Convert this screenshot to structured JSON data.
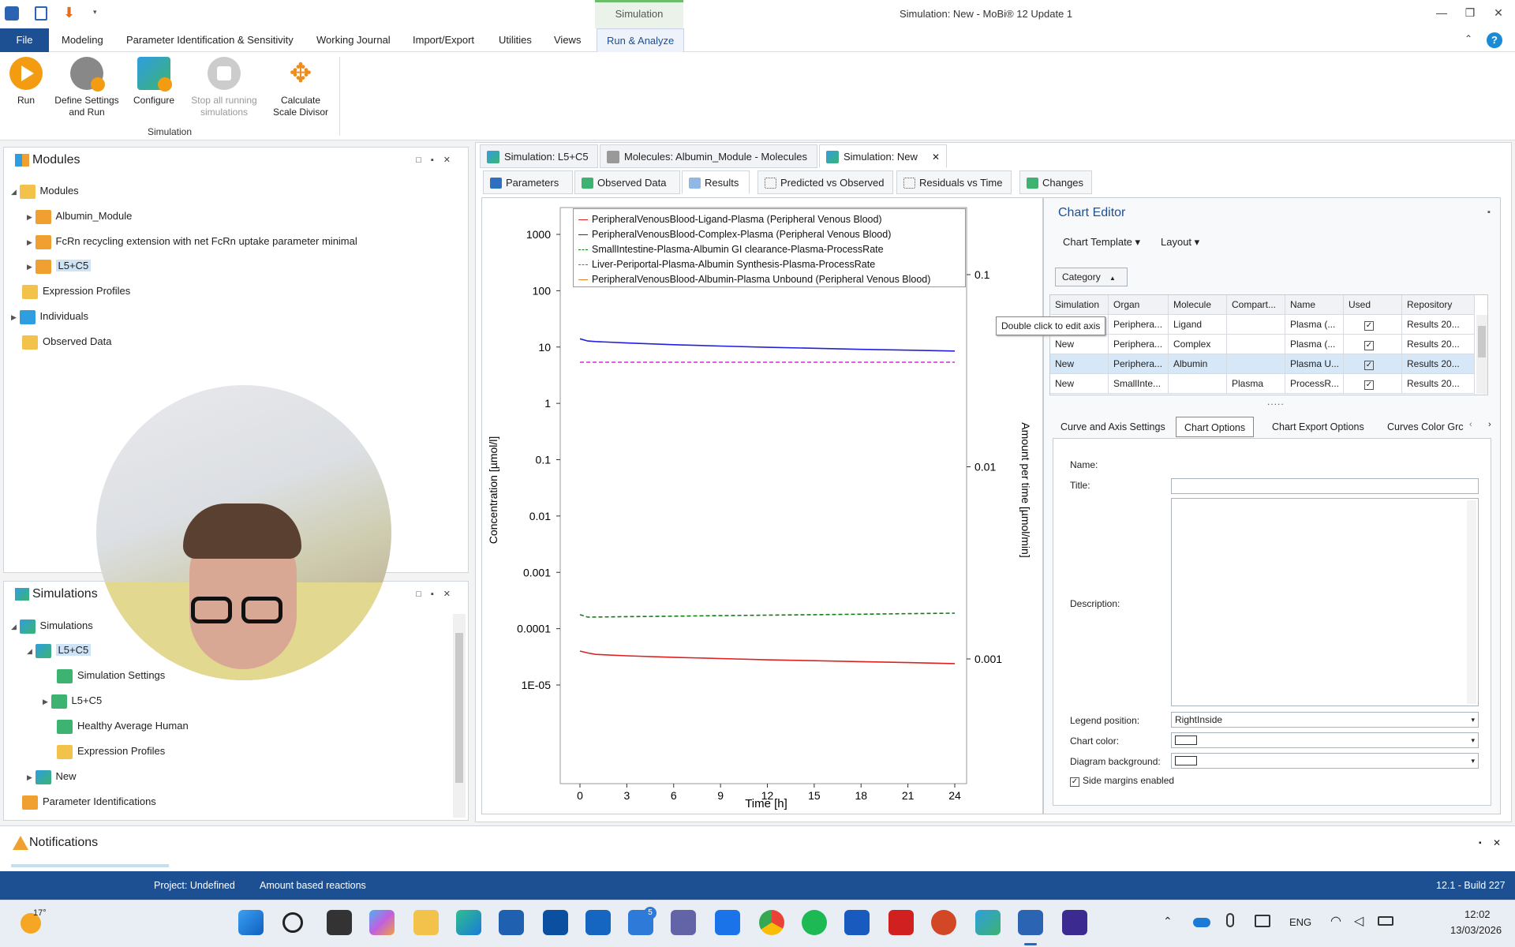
{
  "window": {
    "title": "Simulation: New - MoBi® 12 Update 1",
    "context_tab": "Simulation"
  },
  "menu": {
    "file": "File",
    "items": [
      "Modeling",
      "Parameter Identification & Sensitivity",
      "Working Journal",
      "Import/Export",
      "Utilities",
      "Views",
      "Run & Analyze"
    ]
  },
  "ribbon": {
    "run": "Run",
    "define": "Define Settings and Run",
    "configure": "Configure",
    "stop": "Stop all running simulations",
    "calc": "Calculate Scale Divisor",
    "group": "Simulation"
  },
  "modules_panel": {
    "title": "Modules",
    "nodes": [
      "Modules",
      "Albumin_Module",
      "FcRn recycling extension with net FcRn uptake parameter minimal",
      "L5+C5",
      "Expression Profiles",
      "Individuals",
      "Observed Data"
    ]
  },
  "simulations_panel": {
    "title": "Simulations",
    "nodes": [
      "Simulations",
      "L5+C5",
      "Simulation Settings",
      "L5+C5",
      "Healthy Average Human",
      "Expression Profiles",
      "New",
      "Parameter Identifications"
    ]
  },
  "doc_tabs": [
    "Simulation: L5+C5",
    "Molecules: Albumin_Module - Molecules",
    "Simulation: New"
  ],
  "sub_tabs": [
    "Parameters",
    "Observed Data",
    "Results",
    "Predicted vs Observed",
    "Residuals vs Time",
    "Changes"
  ],
  "chart_data": {
    "type": "line",
    "xlabel": "Time [h]",
    "ylabel": "Concentration [µmol/l]",
    "y2label": "Amount per time [µmol/min]",
    "x_ticks": [
      "0",
      "3",
      "6",
      "9",
      "12",
      "15",
      "18",
      "21",
      "24"
    ],
    "y_ticks": [
      "1000",
      "100",
      "10",
      "1",
      "0.1",
      "0.01",
      "0.001",
      "0.0001",
      "1E-05"
    ],
    "y2_ticks": [
      "0.1",
      "0.01",
      "0.001"
    ],
    "xlim": [
      0,
      24
    ],
    "ylim_log": [
      1e-05,
      1000
    ],
    "y2lim_log": [
      0.001,
      0.1
    ],
    "series": [
      {
        "name": "PeripheralVenousBlood-Ligand-Plasma (Peripheral Venous Blood)",
        "color": "#e02020",
        "dash": "solid",
        "axis": "left",
        "x": [
          0,
          0.5,
          1,
          3,
          6,
          9,
          12,
          15,
          18,
          21,
          24
        ],
        "y": [
          4e-05,
          3.7e-05,
          3.5e-05,
          3.3e-05,
          3.1e-05,
          2.95e-05,
          2.8e-05,
          2.7e-05,
          2.6e-05,
          2.5e-05,
          2.4e-05
        ]
      },
      {
        "name": "PeripheralVenousBlood-Complex-Plasma (Peripheral Venous Blood)",
        "color": "#2020e0",
        "dash": "solid",
        "axis": "left",
        "x": [
          0,
          0.5,
          1,
          3,
          6,
          9,
          12,
          15,
          18,
          21,
          24
        ],
        "y": [
          14,
          12.8,
          12.5,
          11.8,
          11,
          10.4,
          9.9,
          9.5,
          9.1,
          8.8,
          8.5
        ]
      },
      {
        "name": "SmallIntestine-Plasma-Albumin GI clearance-Plasma-ProcessRate",
        "color": "#108010",
        "dash": "dashed",
        "axis": "right",
        "x": [
          0,
          0.5,
          3,
          6,
          9,
          12,
          15,
          18,
          21,
          24
        ],
        "y": [
          0.0017,
          0.00165,
          0.00166,
          0.00167,
          0.00168,
          0.00169,
          0.0017,
          0.00171,
          0.00172,
          0.00173
        ]
      },
      {
        "name": "Liver-Periportal-Plasma-Albumin Synthesis-Plasma-ProcessRate",
        "color": "#e020e0",
        "dash": "dashed",
        "axis": "right",
        "x": [
          0,
          24
        ],
        "y": [
          0.035,
          0.035
        ]
      },
      {
        "name": "PeripheralVenousBlood-Albumin-Plasma Unbound (Peripheral Venous Blood)",
        "color": "#e08020",
        "dash": "solid",
        "axis": "left",
        "x": [],
        "y": []
      }
    ],
    "legend_position": "top-right"
  },
  "tooltip": "Double click to edit axis",
  "editor": {
    "title": "Chart Editor",
    "template": "Chart Template",
    "layout": "Layout",
    "category": "Category",
    "columns": [
      "Simulation",
      "Organ",
      "Molecule",
      "Compart...",
      "Name",
      "Used",
      "Repository"
    ],
    "rows": [
      [
        "",
        "Periphera...",
        "Ligand",
        "",
        "Plasma (...",
        "✓",
        "Results 20..."
      ],
      [
        "New",
        "Periphera...",
        "Complex",
        "",
        "Plasma (...",
        "✓",
        "Results 20..."
      ],
      [
        "New",
        "Periphera...",
        "Albumin",
        "",
        "Plasma U...",
        "✓",
        "Results 20..."
      ],
      [
        "New",
        "SmallInte...",
        "",
        "Plasma",
        "ProcessR...",
        "✓",
        "Results 20..."
      ]
    ],
    "tabs": [
      "Curve and Axis Settings",
      "Chart Options",
      "Chart Export Options",
      "Curves Color Grc"
    ],
    "name_label": "Name:",
    "title_label": "Title:",
    "description_label": "Description:",
    "legend_label": "Legend position:",
    "legend_value": "RightInside",
    "chart_color_label": "Chart color:",
    "diagram_bg_label": "Diagram background:",
    "side_margins": "Side margins enabled"
  },
  "notifications": {
    "title": "Notifications"
  },
  "status": {
    "project": "Project: Undefined",
    "reactions": "Amount based reactions",
    "build": "12.1 - Build 227"
  },
  "taskbar": {
    "weather": "17°",
    "lang": "ENG",
    "time": "12:02",
    "date": "13/03/2026",
    "badge_todo": "5"
  }
}
